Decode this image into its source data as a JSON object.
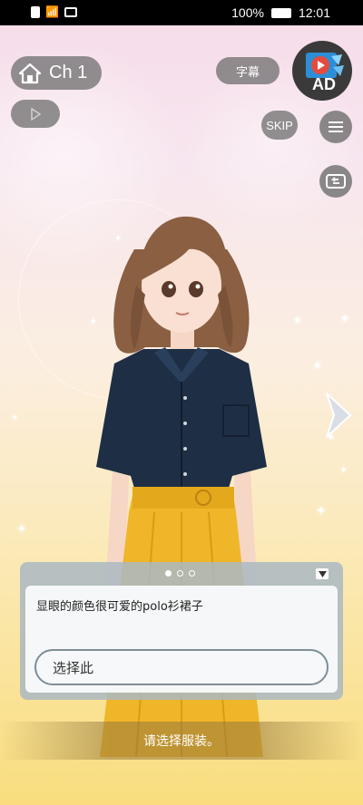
{
  "status_bar": {
    "battery": "100%",
    "time": "12:01"
  },
  "top_bar": {
    "chapter_label": "Ch 1",
    "subtitles_label": "字幕",
    "ad_badge": "AD",
    "skip_label": "SKIP"
  },
  "dialog": {
    "page_dots": 3,
    "active_dot": 1,
    "item_text": "显眼的颜色很可爱的polo衫裙子",
    "choose_label": "选择此"
  },
  "hint": "请选择服装。",
  "colors": {
    "shirt": "#1e2f45",
    "skirt": "#f0b629",
    "hair": "#8a5f42"
  }
}
